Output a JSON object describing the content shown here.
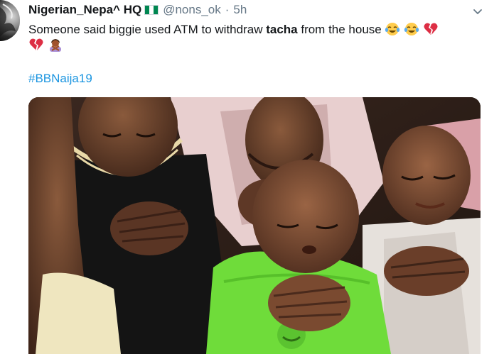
{
  "tweet": {
    "display_name": "Nigerian_Nepa^ HQ",
    "handle": "@nons_ok",
    "separator": "·",
    "time": "5h",
    "text_before": "Someone said biggie used ATM to withdraw ",
    "text_bold": "tacha",
    "text_after": " from the house",
    "hashtag": "#BBNaija19",
    "emojis": [
      "face-with-tears-of-joy",
      "face-with-tears-of-joy",
      "broken-heart",
      "broken-heart",
      "woman-gesturing-no"
    ]
  },
  "colors": {
    "link": "#1b95e0",
    "secondary_text": "#657786",
    "flag_green": "#008751"
  },
  "icons": {
    "menu": "chevron-down-icon"
  }
}
